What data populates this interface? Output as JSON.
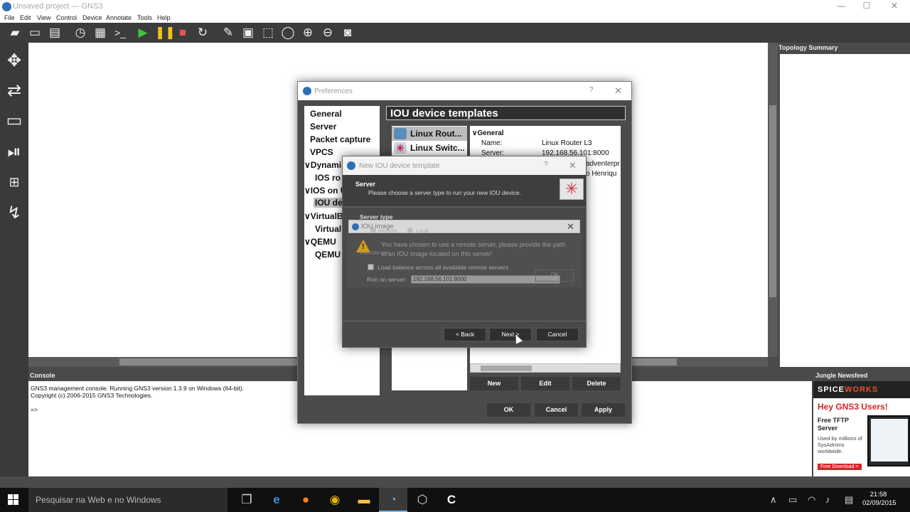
{
  "window": {
    "title": "Unsaved project — GNS3",
    "minimize": "—",
    "maximize": "☐",
    "close": "✕"
  },
  "menu": [
    "File",
    "Edit",
    "View",
    "Control",
    "Device",
    "Annotate",
    "Tools",
    "Help"
  ],
  "toolbar_icons": [
    "new-project-icon",
    "open-project-icon",
    "save-project-icon",
    "snapshot-clock-icon",
    "show-interface-labels-icon",
    "console-all-icon",
    "start-all-icon",
    "suspend-all-icon",
    "stop-all-icon",
    "reload-all-icon",
    "add-note-icon",
    "insert-picture-icon",
    "draw-rectangle-icon",
    "draw-ellipse-icon",
    "zoom-in-icon",
    "zoom-out-icon",
    "screenshot-icon"
  ],
  "dock_icons": [
    "routers-icon",
    "switches-icon",
    "end-devices-icon",
    "security-devices-icon",
    "all-devices-icon",
    "add-link-icon"
  ],
  "topology_summary": {
    "title": "Topology Summary"
  },
  "console": {
    "title": "Console",
    "lines": [
      "GNS3 management console. Running GNS3 version 1.3.9 on Windows (64-bit).",
      "Copyright (c) 2006-2015 GNS3 Technologies.",
      "",
      "=>"
    ]
  },
  "jungle": {
    "title": "Jungle Newsfeed",
    "brand_a": "SPICE",
    "brand_b": "WORKS",
    "headline": "Hey GNS3 Users!",
    "product": "Free TFTP Server",
    "tagline": "Used by millions of SysAdmins worldwide.",
    "button": "Free Download >"
  },
  "preferences": {
    "title": "Preferences",
    "help": "?",
    "close": "✕",
    "nav": [
      {
        "label": "General",
        "indent": false
      },
      {
        "label": "Server",
        "indent": false
      },
      {
        "label": "Packet capture",
        "indent": false
      },
      {
        "label": "VPCS",
        "indent": false
      },
      {
        "label": "∨Dynami",
        "indent": false
      },
      {
        "label": "IOS ro",
        "indent": true
      },
      {
        "label": "∨IOS on U",
        "indent": false
      },
      {
        "label": "IOU de",
        "indent": true
      },
      {
        "label": "∨VirtualB",
        "indent": false
      },
      {
        "label": "Virtual",
        "indent": true
      },
      {
        "label": "∨QEMU",
        "indent": false
      },
      {
        "label": "QEMU",
        "indent": true
      }
    ],
    "heading": "IOU device templates",
    "devices": [
      {
        "label": "Linux Rout...",
        "icon": "router-icon"
      },
      {
        "label": "Linux Switc...",
        "icon": "switch-icon"
      }
    ],
    "detail": {
      "group": "∨General",
      "rows": [
        {
          "key": "Name:",
          "value": "Linux Router L3"
        },
        {
          "key": "Server:",
          "value": "192.168.56.101:8000"
        },
        {
          "key": "",
          "value": "adventerpr"
        },
        {
          "key": "",
          "value": "o Henriqu"
        }
      ]
    },
    "buttons": {
      "new": "New",
      "edit": "Edit",
      "delete": "Delete",
      "ok": "OK",
      "cancel": "Cancel",
      "apply": "Apply"
    }
  },
  "wizard": {
    "title": "New IOU device template",
    "help": "?",
    "close": "✕",
    "section": "Server",
    "subtitle": "Please choose a server type to run your new IOU device.",
    "server_type_label": "Server type",
    "radio_remote": "Remote",
    "radio_local": "Local",
    "back": "< Back",
    "next": "Next >",
    "cancel": "Cancel"
  },
  "remote": {
    "remote_label": "Remote ser",
    "load_balance": "Load balance across all available remote servers",
    "run_on_server_label": "Run on server:",
    "run_on_server_value": "192.168.56.101:8000",
    "ok": "OK"
  },
  "iou_message": {
    "title": "IOU image",
    "close": "✕",
    "text": "You have chosen to use a remote server, please provide the path to an IOU image located on this server!",
    "ghost": "Remote ser"
  },
  "taskbar": {
    "search_placeholder": "Pesquisar na Web e no Windows",
    "time": "21:58",
    "date": "02/09/2015"
  }
}
